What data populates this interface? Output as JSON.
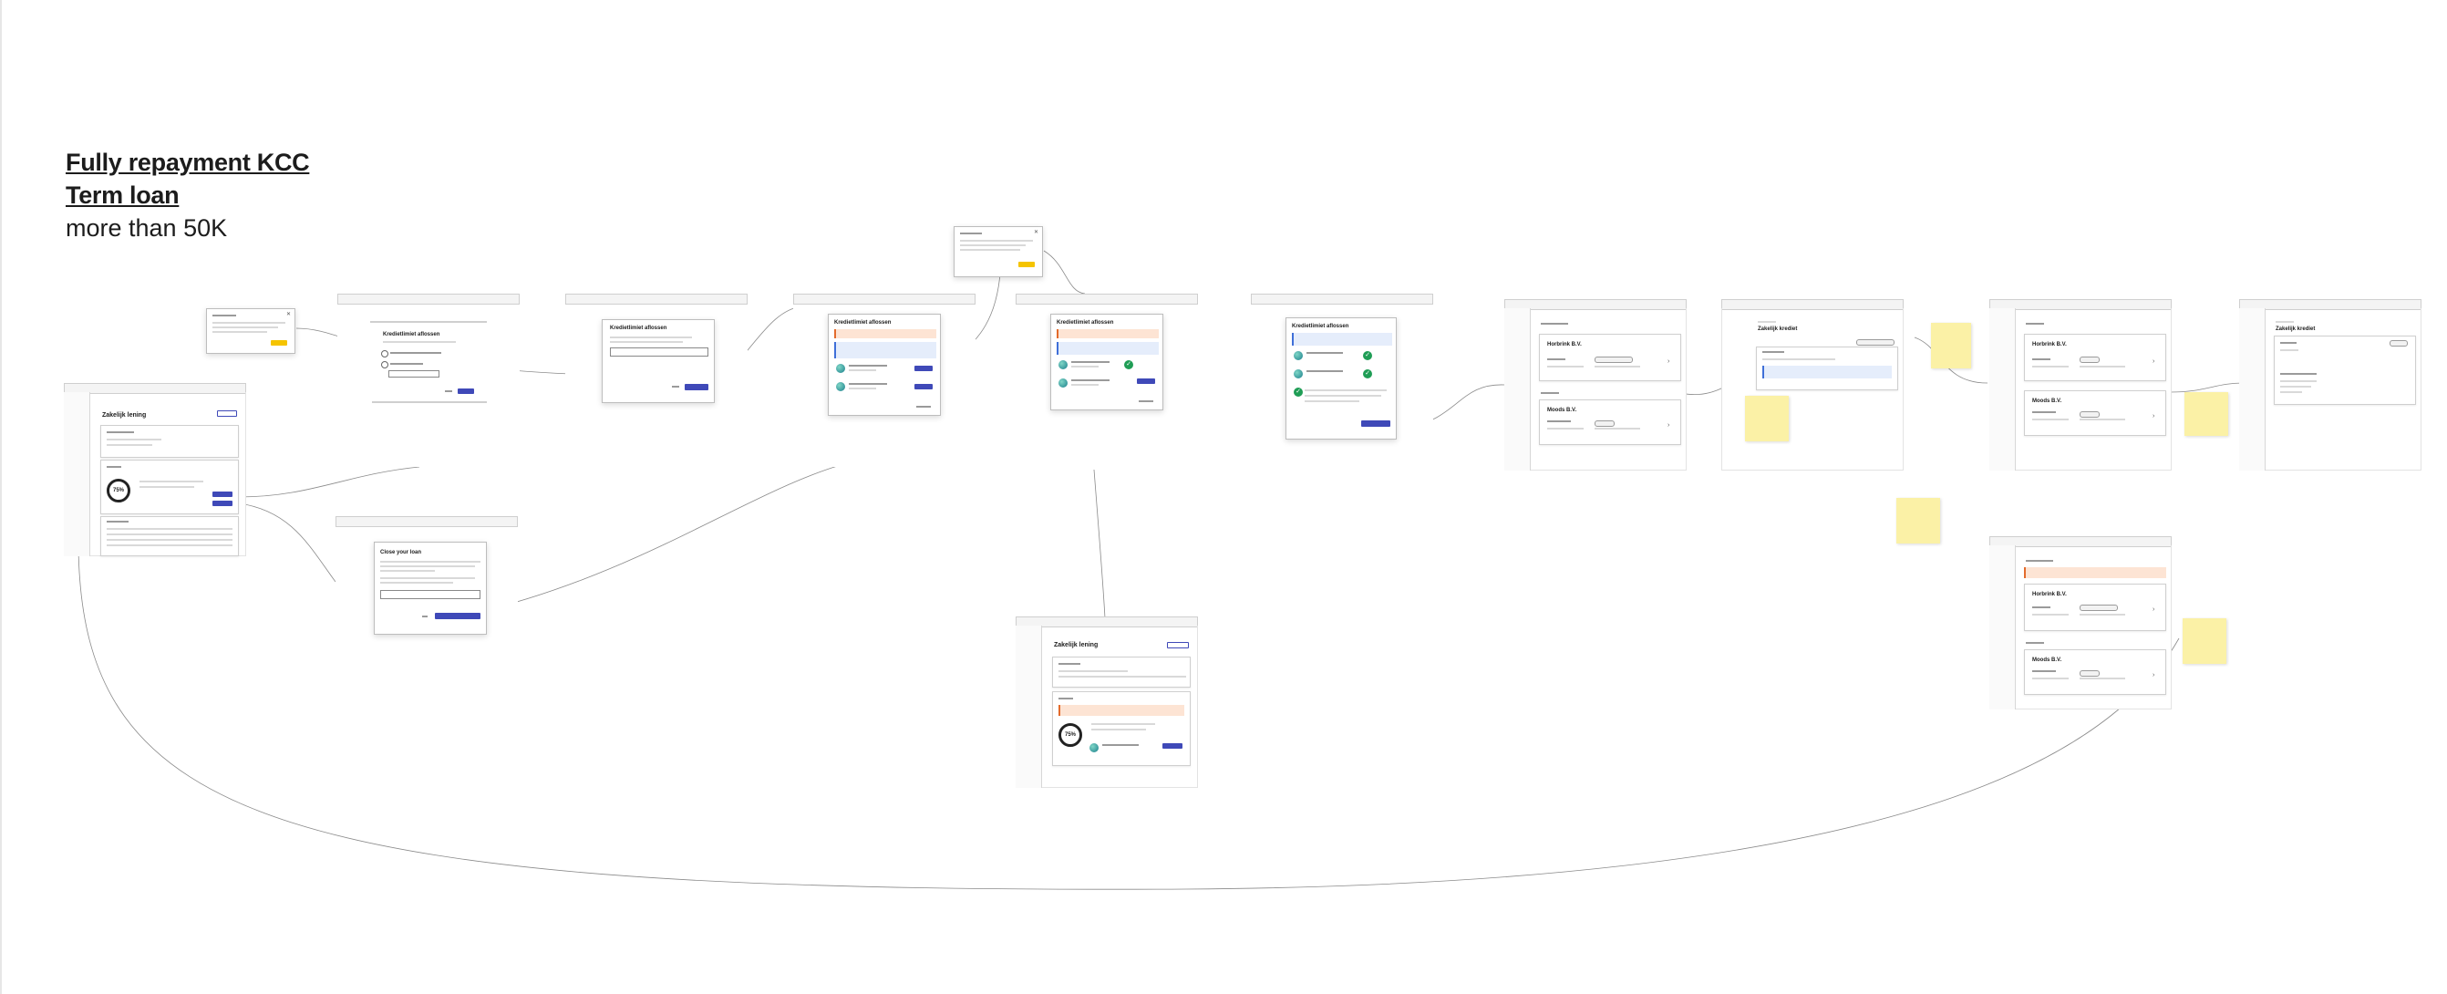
{
  "title": {
    "line1": "Fully repayment KCC",
    "line2": "Term loan",
    "line3": "more than 50K"
  },
  "colors": {
    "primary_button": "#3f49b8",
    "warning": "#fde4d4",
    "info": "#e5edfb",
    "sticky_note": "#fbf1a6",
    "modal_accent": "#f5c400"
  },
  "icons": [
    "globe-icon",
    "check-circle-icon",
    "chevron-right-icon",
    "close-icon"
  ],
  "screens": {
    "overview": {
      "page_title": "Zakelijk lening",
      "gauge_value": "75%"
    },
    "full_repayment_step1": {
      "heading": "Kredietlimiet aflossen"
    },
    "full_repayment_step2": {
      "heading": "Kredietlimiet aflossen"
    },
    "full_repayment_step3": {
      "heading": "Kredietlimiet aflossen"
    },
    "full_repayment_step4": {
      "heading": "Kredietlimiet aflossen"
    },
    "full_repayment_done": {
      "heading": "Kredietlimiet aflossen"
    },
    "close_loan": {
      "heading": "Close your loan"
    },
    "overview_pending": {
      "page_title": "Zakelijk lening",
      "gauge_value": "75%"
    },
    "business_list": {
      "company_1": "Horbrink B.V.",
      "company_2": "Moods B.V."
    },
    "loan_detail": {
      "page_title": "Zakelijk krediet"
    },
    "business_list_settled": {
      "company_1": "Horbrink B.V.",
      "company_2": "Moods B.V."
    },
    "loan_detail_closed": {
      "page_title": "Zakelijk krediet"
    },
    "business_list_alert": {
      "company_1": "Horbrink B.V.",
      "company_2": "Moods B.V."
    }
  }
}
